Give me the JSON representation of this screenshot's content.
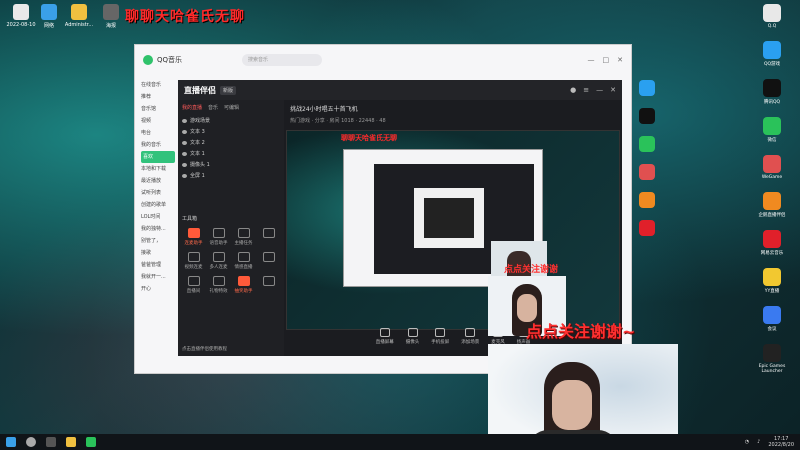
{
  "overlay_title": "聊聊天哈雀氏无聊",
  "overlay_small_title": "聊聊天哈雀氏无聊",
  "desktop_icons": [
    {
      "label": "2022-08-10",
      "color": "#e9e9e9"
    },
    {
      "label": "网络",
      "color": "#3aa0e8"
    },
    {
      "label": "Administr...",
      "color": "#f0c040"
    },
    {
      "label": "海报",
      "color": "#666666"
    }
  ],
  "qq_music": {
    "brand": "QQ音乐",
    "search_placeholder": "搜索音乐",
    "sidebar": [
      "在线音乐",
      "推荐",
      "音乐馆",
      "视频",
      "电台",
      "我的音乐",
      "喜欢",
      "本地和下载",
      "最近播放",
      "试听列表",
      "创建的歌单",
      "LOL时间",
      "我的独特...",
      "别管了，",
      "接歌",
      "爸爸管理",
      "我就开一...",
      "开心"
    ]
  },
  "helper": {
    "brand": "直播伴侣",
    "version": "新版",
    "tabs": [
      "我的直播",
      "音乐",
      "可编辑"
    ],
    "scenes": [
      "游戏场景",
      "文本 3",
      "文本 2",
      "文本 1",
      "摄像头 1",
      "全屏 1"
    ],
    "tools_title": "工具箱",
    "tools": [
      {
        "label": "连麦助手",
        "red": true
      },
      {
        "label": "语音助手",
        "red": false
      },
      {
        "label": "主播任务",
        "red": false
      },
      {
        "label": "",
        "red": false
      },
      {
        "label": "视频连麦",
        "red": false
      },
      {
        "label": "多人连麦",
        "red": false
      },
      {
        "label": "情感直播",
        "red": false
      },
      {
        "label": "",
        "red": false
      },
      {
        "label": "直播间",
        "red": false
      },
      {
        "label": "礼物特效",
        "red": false
      },
      {
        "label": "抽奖助手",
        "red": true
      },
      {
        "label": "",
        "red": false
      }
    ],
    "room_title": "挑战24小时唱五十首飞机",
    "room_meta": "热门游戏 · 分享 · 房间 1018 · 22448 · 48",
    "bottom_controls": [
      "直播屏幕",
      "摄像头",
      "手机投屏",
      "添加场景",
      "麦克风",
      "扬声器"
    ],
    "notice": "点击直播伴侣使用教程"
  },
  "nested_red_text": "点点关注谢谢",
  "big_overlay_text": "点点关注谢谢~",
  "right_icons": [
    {
      "label": "Q.Q",
      "color": "#e8e8e8"
    },
    {
      "label": "QQ游戏",
      "color": "#2aa0f0"
    },
    {
      "label": "腾讯QQ",
      "color": "#111111"
    },
    {
      "label": "微信",
      "color": "#2ac25a"
    },
    {
      "label": "WeGame",
      "color": "#e05050"
    },
    {
      "label": "企鹅直播伴侣",
      "color": "#f08a20"
    },
    {
      "label": "网易云音乐",
      "color": "#e0202a"
    },
    {
      "label": "YY直播",
      "color": "#f2c830"
    },
    {
      "label": "会议",
      "color": "#3a7af0"
    },
    {
      "label": "Epic Games Launcher",
      "color": "#222222"
    }
  ],
  "taskbar": {
    "time": "17:17",
    "date": "2022/8/20"
  }
}
